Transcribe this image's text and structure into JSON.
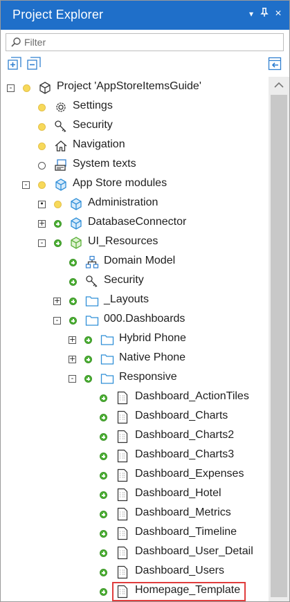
{
  "panel": {
    "title": "Project Explorer",
    "controls": {
      "dropdown": "▾",
      "pin": "ᵽ",
      "close": "×"
    }
  },
  "filter": {
    "placeholder": "Filter",
    "value": ""
  },
  "toolbar": {
    "expand_all": "expand-all-icon",
    "collapse_all": "collapse-all-icon",
    "sync": "sync-with-editor-icon"
  },
  "tree": [
    {
      "label": "Project 'AppStoreItemsGuide'",
      "expander": "-",
      "dot": "yellow",
      "icon": "cube-outline-icon"
    },
    {
      "label": "Settings",
      "dot": "yellow",
      "icon": "gear-icon"
    },
    {
      "label": "Security",
      "dot": "yellow",
      "icon": "key-icon"
    },
    {
      "label": "Navigation",
      "dot": "yellow",
      "icon": "home-icon"
    },
    {
      "label": "System texts",
      "dot": "hollow",
      "icon": "system-texts-icon"
    },
    {
      "label": "App Store modules",
      "expander": "-",
      "dot": "yellow",
      "icon": "blue-cube-icon"
    },
    {
      "label": "Administration",
      "expander": "•",
      "dot": "yellow",
      "icon": "blue-cube-icon"
    },
    {
      "label": "DatabaseConnector",
      "expander": "+",
      "dot": "green",
      "icon": "blue-cube-icon"
    },
    {
      "label": "UI_Resources",
      "expander": "-",
      "dot": "green",
      "icon": "green-cube-icon"
    },
    {
      "label": "Domain Model",
      "dot": "green",
      "icon": "domain-model-icon"
    },
    {
      "label": "Security",
      "dot": "green",
      "icon": "key-icon"
    },
    {
      "label": "_Layouts",
      "expander": "+",
      "dot": "green",
      "icon": "folder-icon"
    },
    {
      "label": "000.Dashboards",
      "expander": "-",
      "dot": "green",
      "icon": "folder-icon"
    },
    {
      "label": "Hybrid Phone",
      "expander": "+",
      "dot": "green",
      "icon": "folder-icon"
    },
    {
      "label": "Native Phone",
      "expander": "+",
      "dot": "green",
      "icon": "folder-icon"
    },
    {
      "label": "Responsive",
      "expander": "-",
      "dot": "green",
      "icon": "folder-icon"
    },
    {
      "label": "Dashboard_ActionTiles",
      "dot": "green",
      "icon": "page-icon"
    },
    {
      "label": "Dashboard_Charts",
      "dot": "green",
      "icon": "page-icon"
    },
    {
      "label": "Dashboard_Charts2",
      "dot": "green",
      "icon": "page-icon"
    },
    {
      "label": "Dashboard_Charts3",
      "dot": "green",
      "icon": "page-icon"
    },
    {
      "label": "Dashboard_Expenses",
      "dot": "green",
      "icon": "page-icon"
    },
    {
      "label": "Dashboard_Hotel",
      "dot": "green",
      "icon": "page-icon"
    },
    {
      "label": "Dashboard_Metrics",
      "dot": "green",
      "icon": "page-icon"
    },
    {
      "label": "Dashboard_Timeline",
      "dot": "green",
      "icon": "page-icon"
    },
    {
      "label": "Dashboard_User_Detail",
      "dot": "green",
      "icon": "page-icon"
    },
    {
      "label": "Dashboard_Users",
      "dot": "green",
      "icon": "page-icon"
    },
    {
      "label": "Homepage_Template",
      "dot": "green",
      "icon": "page-icon",
      "highlighted": true
    }
  ],
  "colors": {
    "titlebar": "#1f6fc9",
    "highlight": "#e03c3c",
    "folder": "#2f8fd8",
    "dot_green": "#4caf35",
    "dot_yellow": "#f7d95a"
  }
}
